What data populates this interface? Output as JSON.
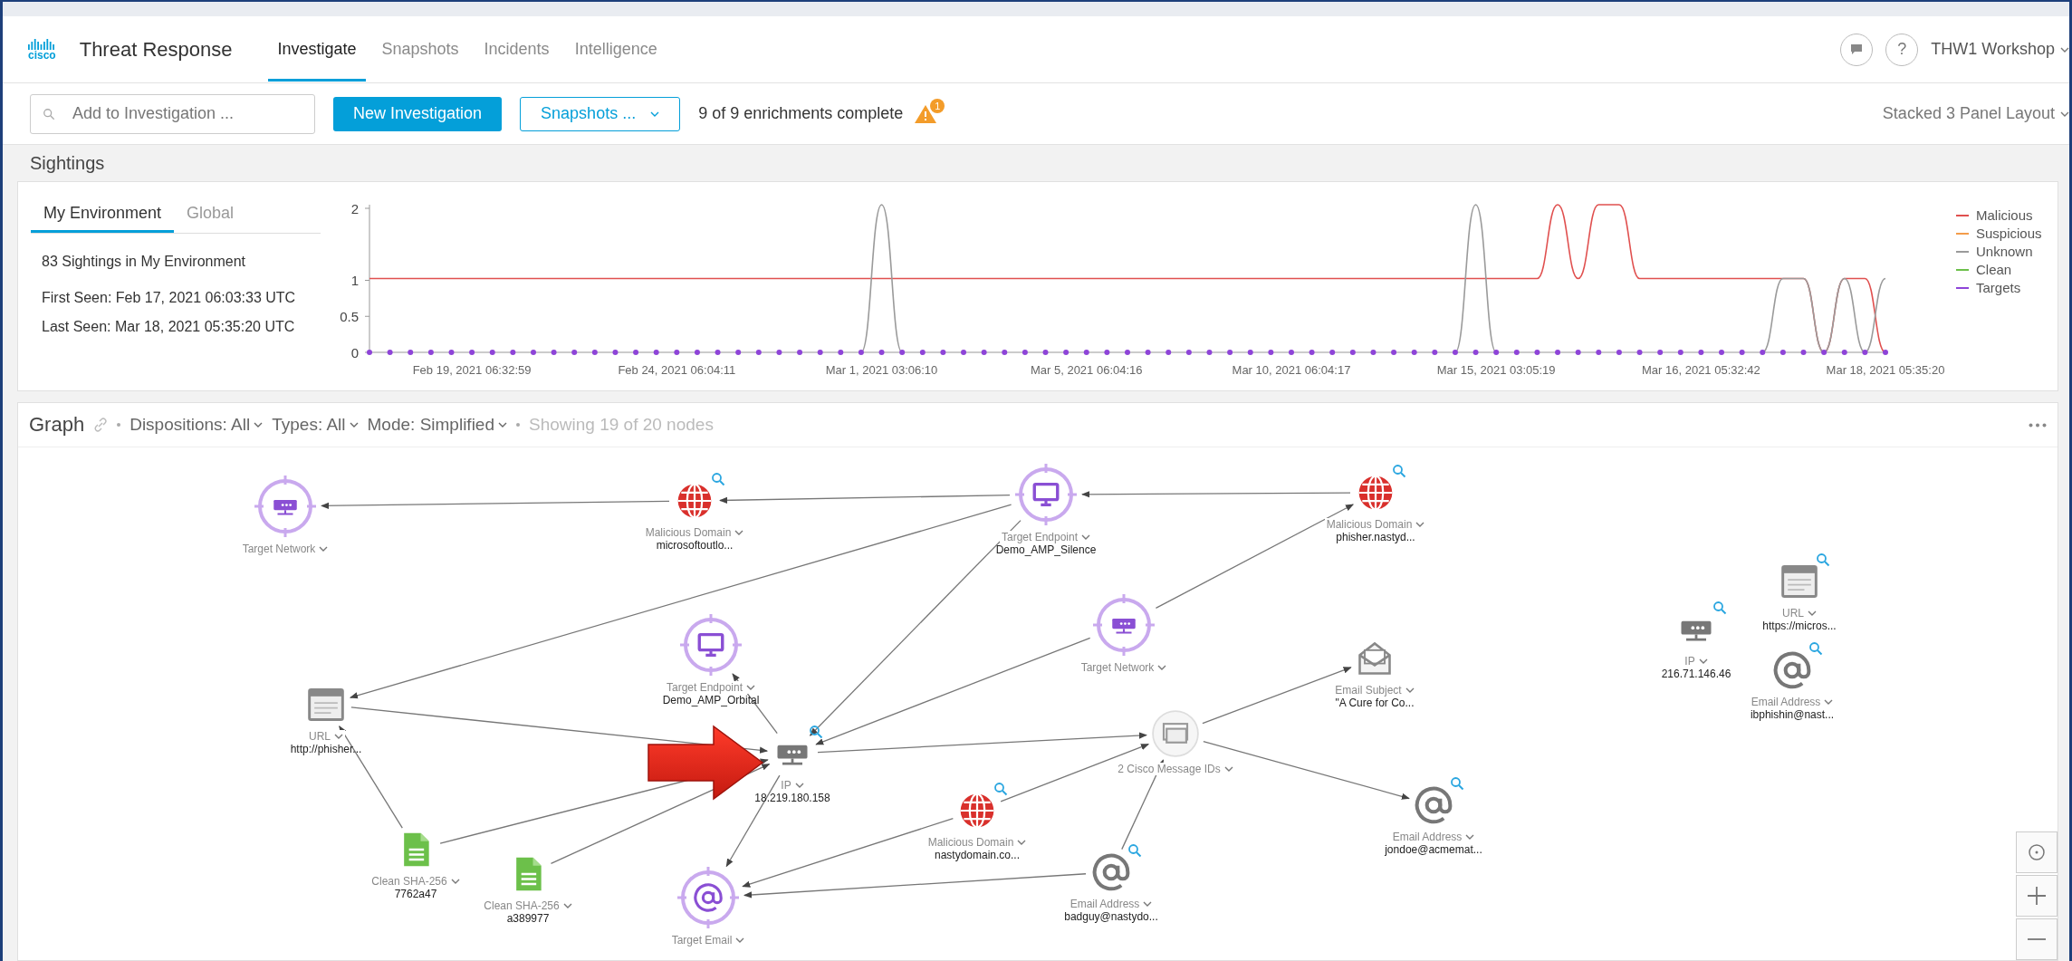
{
  "header": {
    "logo": "cisco",
    "app_title": "Threat Response",
    "tabs": [
      {
        "label": "Investigate",
        "selected": true
      },
      {
        "label": "Snapshots",
        "selected": false
      },
      {
        "label": "Incidents",
        "selected": false
      },
      {
        "label": "Intelligence",
        "selected": false
      }
    ],
    "help": "?",
    "account": "THW1 Workshop"
  },
  "toolbar": {
    "search": {
      "placeholder": "Add to Investigation ..."
    },
    "new_button": "New Investigation",
    "snapshots_dropdown": "Snapshots ...",
    "status": "9 of 9 enrichments complete",
    "warning_count": "1",
    "layout_menu": "Stacked 3 Panel Layout"
  },
  "sightings": {
    "title": "Sightings",
    "tabs": [
      {
        "label": "My Environment",
        "selected": true
      },
      {
        "label": "Global",
        "selected": false
      }
    ],
    "summary": "83 Sightings in My Environment",
    "first_seen": "First Seen: Feb 17, 2021 06:03:33 UTC",
    "last_seen": "Last Seen: Mar 18, 2021 05:35:20 UTC",
    "chart_data": {
      "type": "line",
      "ylim": [
        0,
        2
      ],
      "yticks": [
        0,
        0.5,
        1,
        2
      ],
      "categories": [
        null,
        null,
        null,
        null,
        null,
        "Feb 19, 2021 06:32:59",
        null,
        null,
        null,
        null,
        null,
        null,
        null,
        null,
        null,
        "Feb 24, 2021 06:04:11",
        null,
        null,
        null,
        null,
        null,
        null,
        null,
        null,
        null,
        "Mar 1, 2021 03:06:10",
        null,
        null,
        null,
        null,
        null,
        null,
        null,
        null,
        null,
        "Mar 5, 2021 06:04:16",
        null,
        null,
        null,
        null,
        null,
        null,
        null,
        null,
        null,
        "Mar 10, 2021 06:04:17",
        null,
        null,
        null,
        null,
        null,
        null,
        null,
        null,
        null,
        "Mar 15, 2021 03:05:19",
        null,
        null,
        null,
        null,
        null,
        null,
        null,
        null,
        null,
        "Mar 16, 2021 05:32:42",
        null,
        null,
        null,
        null,
        null,
        null,
        null,
        null,
        "Mar 18, 2021 05:35:20"
      ],
      "series": [
        {
          "name": "Malicious",
          "color": "#e0504f",
          "values": [
            1,
            1,
            1,
            1,
            1,
            1,
            1,
            1,
            1,
            1,
            1,
            1,
            1,
            1,
            1,
            1,
            1,
            1,
            1,
            1,
            1,
            1,
            1,
            1,
            1,
            1,
            1,
            1,
            1,
            1,
            1,
            1,
            1,
            1,
            1,
            1,
            1,
            1,
            1,
            1,
            1,
            1,
            1,
            1,
            1,
            1,
            1,
            1,
            1,
            1,
            1,
            1,
            1,
            1,
            1,
            1,
            1,
            1,
            2,
            1,
            2,
            2,
            1,
            1,
            1,
            1,
            1,
            1,
            1,
            1,
            1,
            0,
            1,
            1,
            0
          ]
        },
        {
          "name": "Suspicious",
          "color": "#f39c4a",
          "values": [
            null,
            null,
            null,
            null,
            null,
            null,
            null,
            null,
            null,
            null,
            null,
            null,
            null,
            null,
            null,
            null,
            null,
            null,
            null,
            null,
            null,
            null,
            null,
            null,
            null,
            null,
            null,
            null,
            null,
            null,
            null,
            null,
            null,
            null,
            null,
            null,
            null,
            null,
            null,
            null,
            null,
            null,
            null,
            null,
            null,
            null,
            null,
            null,
            null,
            null,
            null,
            null,
            null,
            null,
            null,
            null,
            null,
            null,
            null,
            null,
            null,
            null,
            null,
            null,
            null,
            null,
            null,
            null,
            null,
            null,
            null,
            null,
            null,
            null,
            null
          ]
        },
        {
          "name": "Unknown",
          "color": "#9a9a9a",
          "values": [
            null,
            null,
            null,
            null,
            null,
            null,
            null,
            null,
            null,
            null,
            null,
            null,
            null,
            null,
            null,
            null,
            null,
            null,
            null,
            null,
            null,
            null,
            null,
            null,
            0,
            2,
            0,
            null,
            null,
            null,
            null,
            null,
            null,
            null,
            null,
            null,
            null,
            null,
            null,
            null,
            null,
            null,
            null,
            null,
            null,
            null,
            null,
            null,
            null,
            null,
            null,
            null,
            null,
            0,
            2,
            0,
            null,
            null,
            null,
            null,
            null,
            null,
            null,
            null,
            null,
            null,
            null,
            null,
            0,
            1,
            1,
            0,
            1,
            0,
            1
          ]
        },
        {
          "name": "Clean",
          "color": "#6cc04a",
          "values": [
            null,
            null,
            null,
            null,
            null,
            null,
            null,
            null,
            null,
            null,
            null,
            null,
            null,
            null,
            null,
            null,
            null,
            null,
            null,
            null,
            null,
            null,
            null,
            null,
            null,
            null,
            null,
            null,
            null,
            null,
            null,
            null,
            null,
            null,
            null,
            null,
            null,
            null,
            null,
            null,
            null,
            null,
            null,
            null,
            null,
            null,
            null,
            null,
            null,
            null,
            null,
            null,
            null,
            null,
            null,
            null,
            null,
            null,
            null,
            null,
            null,
            null,
            null,
            null,
            null,
            null,
            null,
            null,
            null,
            null,
            null,
            null,
            null,
            null,
            null
          ]
        },
        {
          "name": "Targets",
          "color": "#8e44d8",
          "marker": "circle",
          "values": [
            0,
            0,
            0,
            0,
            0,
            0,
            0,
            0,
            0,
            0,
            0,
            0,
            0,
            0,
            0,
            0,
            0,
            0,
            0,
            0,
            0,
            0,
            0,
            0,
            0,
            0,
            0,
            0,
            0,
            0,
            0,
            0,
            0,
            0,
            0,
            0,
            0,
            0,
            0,
            0,
            0,
            0,
            0,
            0,
            0,
            0,
            0,
            0,
            0,
            0,
            0,
            0,
            0,
            0,
            0,
            0,
            0,
            0,
            0,
            0,
            0,
            0,
            0,
            0,
            0,
            0,
            0,
            0,
            0,
            0,
            0,
            0,
            0,
            0,
            0
          ]
        }
      ]
    }
  },
  "graph": {
    "title": "Graph",
    "filters": [
      "Dispositions: All",
      "Types: All",
      "Mode: Simplified"
    ],
    "node_count": "Showing 19 of 20 nodes",
    "nodes": [
      {
        "kind": "target-network",
        "type": "Target Network",
        "lookup": false
      },
      {
        "kind": "domain",
        "type": "Malicious Domain",
        "value": "microsoftoutlo...",
        "lookup": true
      },
      {
        "kind": "target-endpoint",
        "type": "Target Endpoint",
        "value": "Demo_AMP_Silence",
        "lookup": false
      },
      {
        "kind": "domain",
        "type": "Malicious Domain",
        "value": "phisher.nastyd...",
        "lookup": true
      },
      {
        "kind": "target-endpoint",
        "type": "Target Endpoint",
        "value": "Demo_AMP_Orbital",
        "lookup": false
      },
      {
        "kind": "target-network",
        "type": "Target Network",
        "lookup": false
      },
      {
        "kind": "url",
        "type": "URL",
        "value": "http://phisher...",
        "lookup": false
      },
      {
        "kind": "ip",
        "type": "IP",
        "value": "18.219.180.158",
        "lookup": true
      },
      {
        "kind": "message-ids",
        "type": "2 Cisco Message IDs",
        "lookup": false
      },
      {
        "kind": "subject",
        "type": "Email Subject",
        "value": "\"A Cure for Co...",
        "lookup": false
      },
      {
        "kind": "file",
        "type": "Clean SHA-256",
        "value": "7762a47",
        "lookup": false
      },
      {
        "kind": "file",
        "type": "Clean SHA-256",
        "value": "a389977",
        "lookup": false
      },
      {
        "kind": "target-email",
        "type": "Target Email",
        "lookup": false
      },
      {
        "kind": "domain",
        "type": "Malicious Domain",
        "value": "nastydomain.co...",
        "lookup": true
      },
      {
        "kind": "email",
        "type": "Email Address",
        "value": "badguy@nastydo...",
        "lookup": true
      },
      {
        "kind": "email",
        "type": "Email Address",
        "value": "jondoe@acmemat...",
        "lookup": true
      },
      {
        "kind": "ip",
        "type": "IP",
        "value": "216.71.146.46",
        "lookup": true
      },
      {
        "kind": "url",
        "type": "URL",
        "value": "https://micros...",
        "lookup": true
      },
      {
        "kind": "email",
        "type": "Email Address",
        "value": "ibphishin@nast...",
        "lookup": true
      }
    ]
  }
}
